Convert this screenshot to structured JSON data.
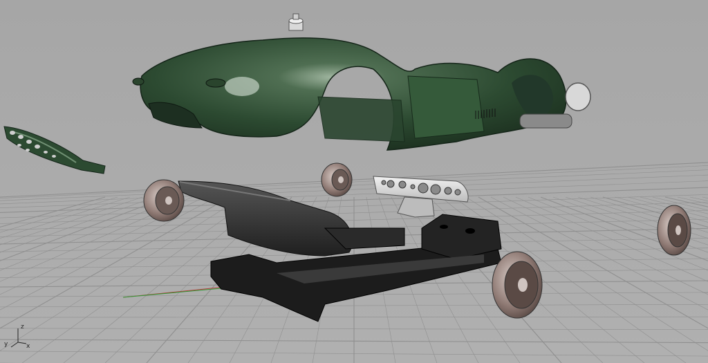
{
  "viewport": {
    "name": "Perspective",
    "background_color": "#aaaaaa",
    "grid_color": "#8f8f8f",
    "x_axis_color": "#b43c3c",
    "y_axis_color": "#2f9a35"
  },
  "world_axes": {
    "z_label": "z",
    "y_label": "y",
    "x_label": "x"
  },
  "model_parts": [
    {
      "name": "car-body-shell",
      "color": "#2c4a31"
    },
    {
      "name": "front-panel",
      "color": "#2c4a31"
    },
    {
      "name": "floor-pan",
      "color": "#2d2d2d"
    },
    {
      "name": "chassis-frame",
      "color": "#1a1a1a"
    },
    {
      "name": "dashboard",
      "color": "#d9d9d9"
    },
    {
      "name": "wheels",
      "color": "#8f7a74"
    },
    {
      "name": "headlamp-lens",
      "color": "#d8d8d8"
    }
  ]
}
